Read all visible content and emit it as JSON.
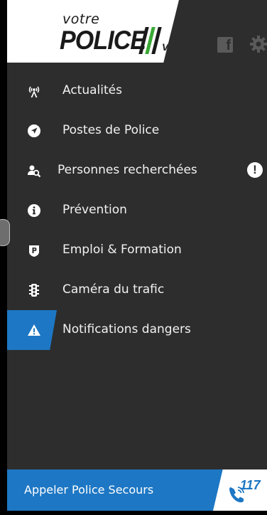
{
  "header": {
    "logo_votre": "votre",
    "logo_police": "POLICE",
    "logo_vd": "VD",
    "facebook_icon": "facebook-icon",
    "settings_icon": "gear-icon"
  },
  "menu": {
    "items": [
      {
        "label": "Actualités",
        "icon": "antenna-icon"
      },
      {
        "label": "Postes de Police",
        "icon": "navigation-icon"
      },
      {
        "label": "Personnes recherchées",
        "icon": "person-search-icon",
        "badge": "!"
      },
      {
        "label": "Prévention",
        "icon": "info-icon"
      },
      {
        "label": "Emploi & Formation",
        "icon": "police-badge-icon"
      },
      {
        "label": "Caméra du trafic",
        "icon": "traffic-light-icon"
      },
      {
        "label": "Notifications dangers",
        "icon": "warning-icon",
        "active": true
      }
    ]
  },
  "footer": {
    "label": "Appeler Police Secours",
    "number": "117",
    "icon": "phone-icon"
  },
  "colors": {
    "background": "#2d2d2d",
    "accent": "#1d77c4",
    "logo_slash_white": "#ffffff",
    "logo_slash_green": "#3aa935",
    "logo_slash_black": "#1a1a1a"
  }
}
